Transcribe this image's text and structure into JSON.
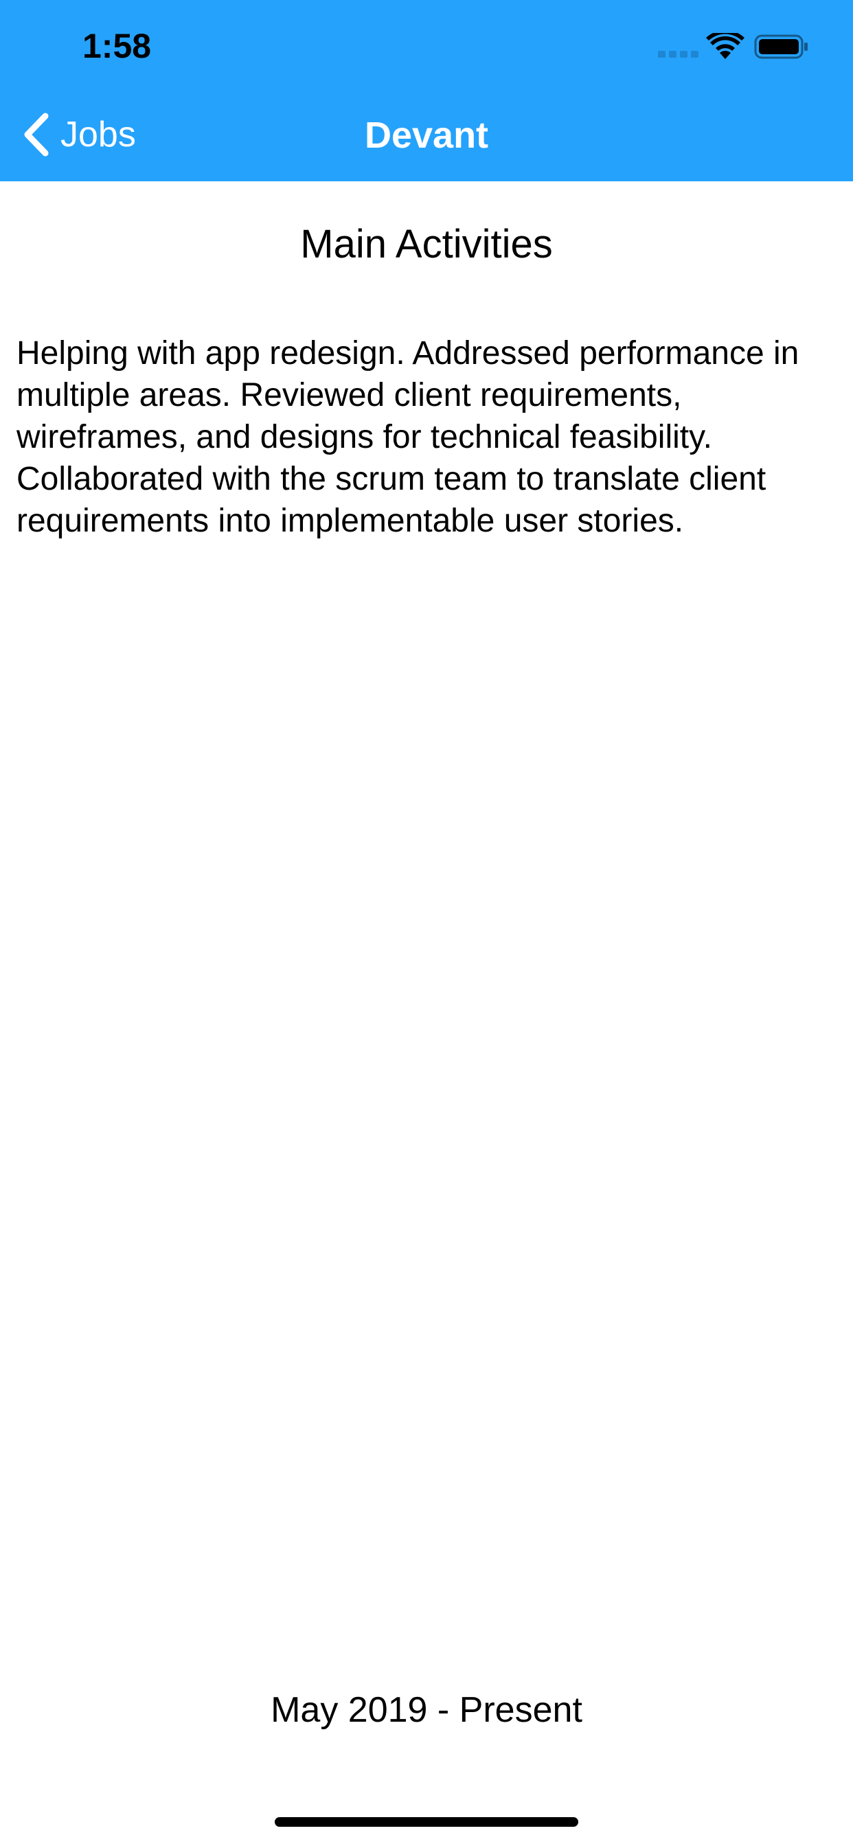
{
  "status_bar": {
    "time": "1:58"
  },
  "nav": {
    "back_label": "Jobs",
    "title": "Devant"
  },
  "content": {
    "heading": "Main Activities",
    "description": "Helping with app redesign. Addressed performance in multiple areas. Reviewed client requirements, wireframes, and designs for technical feasibility. Collaborated with the scrum team to translate client requirements into implementable user stories.",
    "date_range": "May 2019 - Present"
  },
  "icons": {
    "signal": "cellular-signal-icon",
    "wifi": "wifi-icon",
    "battery": "battery-icon",
    "back": "chevron-left-icon"
  },
  "colors": {
    "nav_background": "#25A2FC",
    "nav_text": "#FFFFFF",
    "body_text": "#000000"
  }
}
